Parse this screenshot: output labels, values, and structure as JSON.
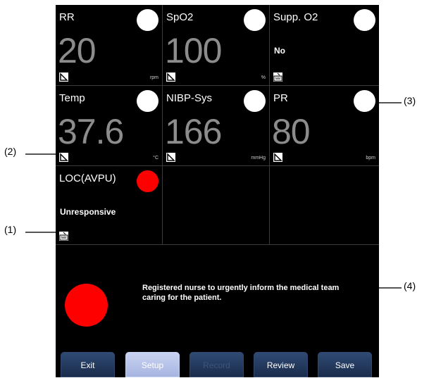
{
  "tiles": {
    "rr": {
      "label": "RR",
      "value": "20",
      "unit": "rpm"
    },
    "spo2": {
      "label": "SpO2",
      "value": "100",
      "unit": "%"
    },
    "o2": {
      "label": "Supp. O2",
      "value": "No"
    },
    "temp": {
      "label": "Temp",
      "value": "37.6",
      "unit": "°C"
    },
    "nibp": {
      "label": "NIBP-Sys",
      "value": "166",
      "unit": "mmHg"
    },
    "pr": {
      "label": "PR",
      "value": "80",
      "unit": "bpm"
    },
    "loc": {
      "label": "LOC(AVPU)",
      "value": "Unresponsive"
    }
  },
  "alert": {
    "message": "Registered nurse to urgently inform the medical team caring for the patient."
  },
  "buttons": {
    "exit": "Exit",
    "setup": "Setup",
    "record": "Record",
    "review": "Review",
    "save": "Save"
  },
  "callouts": {
    "c1": "(1)",
    "c2": "(2)",
    "c3": "(3)",
    "c4": "(4)"
  },
  "colors": {
    "background": "#000000",
    "value_gray": "#8c8c8c",
    "alert_red": "#ff0000",
    "button_blue": "#2f4a73",
    "button_active": "#c9d3f2"
  },
  "icons": {
    "auto": "measure-mode-auto-icon",
    "manual": "manual-entry-icon"
  }
}
